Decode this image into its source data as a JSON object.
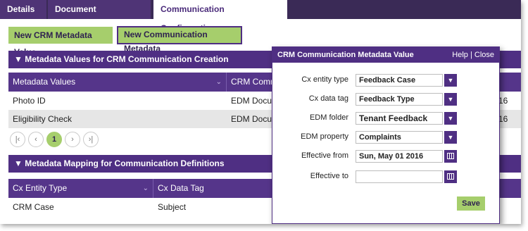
{
  "tabs": [
    {
      "label": "Details"
    },
    {
      "label": "Document Management"
    },
    {
      "label": "Communication Configuration"
    }
  ],
  "toolbar": {
    "new_metadata_value": "New CRM Metadata Value",
    "new_comm_metadata": "New Communication Metadata"
  },
  "section1": {
    "title": "▼ Metadata Values for CRM Communication Creation",
    "columns": [
      "Metadata Values",
      "CRM Commu"
    ],
    "rows": [
      {
        "c1": "Photo ID",
        "c2": "EDM Docume",
        "c3": "16"
      },
      {
        "c1": "Eligibility Check",
        "c2": "EDM Docume",
        "c3": "16"
      }
    ]
  },
  "pager": {
    "first": "|‹",
    "prev": "‹",
    "current": "1",
    "next": "›",
    "last": "›|"
  },
  "section2": {
    "title": "▼ Metadata Mapping for Communication Definitions",
    "columns": [
      "Cx Entity Type",
      "Cx Data Tag"
    ],
    "rows": [
      {
        "c1": "CRM Case",
        "c2": "Subject"
      }
    ]
  },
  "dialog": {
    "title": "CRM Communication Metadata Value",
    "help": "Help",
    "separator": "|",
    "close": "Close",
    "fields": {
      "entity_type": {
        "label": "Cx entity type",
        "value": "Feedback Case"
      },
      "data_tag": {
        "label": "Cx data tag",
        "value": "Feedback Type"
      },
      "edm_folder": {
        "label": "EDM folder",
        "value": "Tenant Feedback"
      },
      "edm_property": {
        "label": "EDM property",
        "value": "Complaints"
      },
      "effective_from": {
        "label": "Effective from",
        "value": "Sun, May 01 2016"
      },
      "effective_to": {
        "label": "Effective to",
        "value": ""
      }
    },
    "save": "Save"
  },
  "colors": {
    "brand": "#4f2f83",
    "accent": "#a6ce6c",
    "tab_dark": "#3a2a56"
  },
  "icons": {
    "dropdown": "chevron-down-icon",
    "calendar": "calendar-icon",
    "sort": "chevron-down-icon"
  }
}
